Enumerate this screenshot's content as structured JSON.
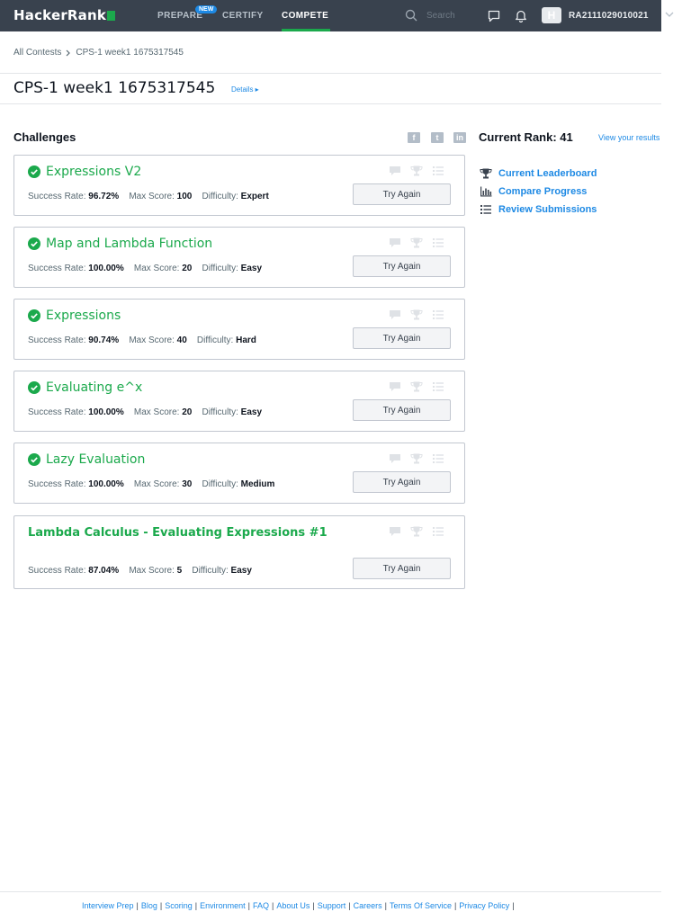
{
  "nav": {
    "logo": "HackerRank",
    "links": [
      {
        "label": "PREPARE",
        "badge": "NEW"
      },
      {
        "label": "CERTIFY"
      },
      {
        "label": "COMPETE",
        "active": true
      }
    ],
    "search_placeholder": "Search",
    "avatar_letter": "H",
    "username": "RA2111029010021"
  },
  "breadcrumb": [
    "All Contests",
    "CPS-1 week1 1675317545"
  ],
  "page": {
    "title": "CPS-1 week1 1675317545",
    "details": "Details ▸"
  },
  "challenges": {
    "heading": "Challenges",
    "labels": {
      "success": "Success Rate:",
      "max": "Max Score:",
      "difficulty": "Difficulty:"
    },
    "items": [
      {
        "title": "Expressions V2",
        "solved": true,
        "success": "96.72%",
        "max": "100",
        "difficulty": "Expert",
        "button": "Try Again"
      },
      {
        "title": "Map and Lambda Function",
        "solved": true,
        "success": "100.00%",
        "max": "20",
        "difficulty": "Easy",
        "button": "Try Again"
      },
      {
        "title": "Expressions",
        "solved": true,
        "success": "90.74%",
        "max": "40",
        "difficulty": "Hard",
        "button": "Try Again"
      },
      {
        "title": "Evaluating e^x",
        "solved": true,
        "success": "100.00%",
        "max": "20",
        "difficulty": "Easy",
        "button": "Try Again"
      },
      {
        "title": "Lazy Evaluation",
        "solved": true,
        "success": "100.00%",
        "max": "30",
        "difficulty": "Medium",
        "button": "Try Again"
      },
      {
        "title": "Lambda Calculus - Evaluating Expressions #1",
        "solved": false,
        "success": "87.04%",
        "max": "5",
        "difficulty": "Easy",
        "button": "Try Again"
      }
    ]
  },
  "sidebar": {
    "rank_label": "Current Rank: 41",
    "view_results": "View your results",
    "links": [
      "Current Leaderboard",
      "Compare Progress",
      "Review Submissions"
    ]
  },
  "footer": {
    "links": [
      "Interview Prep",
      "Blog",
      "Scoring",
      "Environment",
      "FAQ",
      "About Us",
      "Support",
      "Careers",
      "Terms Of Service",
      "Privacy Policy"
    ]
  },
  "colors": {
    "nav_bg": "#39424e",
    "accent_green": "#1ba94c",
    "link_blue": "#1d89e4"
  }
}
